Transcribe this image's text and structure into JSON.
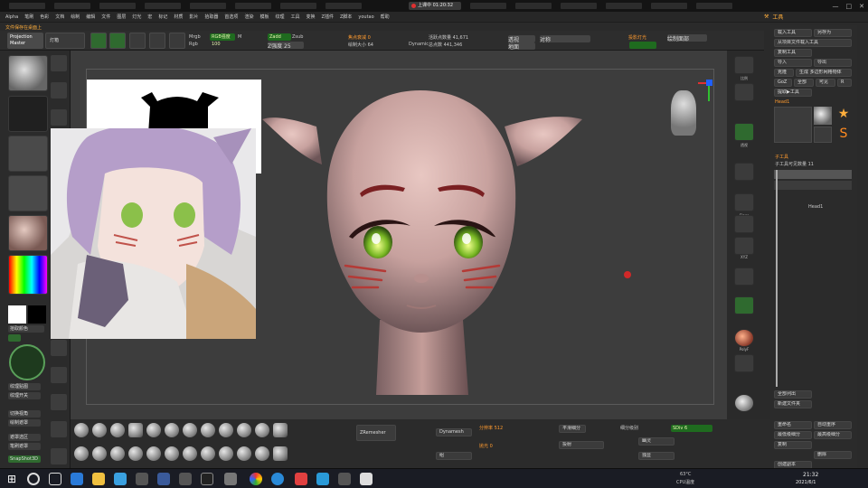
{
  "recording": {
    "label": "上课中 01:20:32"
  },
  "menu": [
    "Alpha",
    "笔刷",
    "色彩",
    "文档",
    "绘制",
    "编辑",
    "文件",
    "图层",
    "灯光",
    "宏",
    "标记",
    "材质",
    "影片",
    "拾取器",
    "首选项",
    "渲染",
    "模板",
    "纹理",
    "工具",
    "变换",
    "Z插件",
    "Z脚本",
    "youtao",
    "帮助"
  ],
  "tools_header": "工具",
  "notice": "文件保存在桌面上",
  "projection_master": "Projection Master",
  "lightbox_label": "灯箱",
  "shelf": {
    "edit": "编辑",
    "draw": "绘制",
    "move": "移动",
    "scale": "缩放",
    "rotate": "旋转",
    "mrgb_label": "Mrgb",
    "rgb_label": "Rgb",
    "m_label": "M",
    "zadd_label": "Zadd",
    "zsub_label": "Zsub",
    "zcut_label": "Zcut",
    "focal_label": "焦点衰减 0",
    "draw_size": "绘制大小 64",
    "dynamic_label": "Dynamic",
    "active_points": "活跃点数量 41,671",
    "total_points": "总点数 441,346",
    "rgb_intensity": "RGB强度 100",
    "z_intensity": "Z强度 25",
    "persp_label": "透视",
    "floor_label": "地面",
    "axis_label": "对称",
    "spotlight": "投影灯光",
    "mesh_label": "绘制面部"
  },
  "left": {
    "color_label": "拾取颜色",
    "btns": [
      "纹理贴图",
      "纹理开关",
      "切换视角",
      "绘制遮罩",
      "遮罩选区",
      "笔刷遮罩",
      "SnapShot3D"
    ],
    "gizmo_labels": [
      "DragDot",
      "Maskpen",
      "DragRect",
      "Move",
      "Clip",
      "Sel_Rect",
      "Sel_Lasso"
    ]
  },
  "dock": [
    "比例",
    "透视",
    "Floor",
    "本地",
    "L.Sym",
    "XYZ",
    "Frame",
    "移动",
    "缩放",
    "旋转",
    "PolyF",
    "Transp",
    "Ghost",
    "Solo",
    "Xpose"
  ],
  "rpanel": {
    "btns_top": [
      "载入工具",
      "另存为",
      "从项目文件载入工具",
      "复制工具",
      "导入",
      "导出",
      "克隆",
      "生成 多边形网格物体",
      "GoZ",
      "全部",
      "可见",
      "R",
      "提取▶工具"
    ],
    "tool_name": "Head1",
    "subtool_header": "子工具",
    "subtool_count": "子工具可见数量 11",
    "subtool_item": "Head1",
    "btns_mid": [
      "全部列出",
      "新建文件夹"
    ],
    "btns_bottom": [
      "重命名",
      "自动重序",
      "最低级细分",
      "最高级细分",
      "复制",
      "删除",
      "创建副本",
      "附加",
      "移除"
    ]
  },
  "bottom": {
    "brushes": [
      "Standard",
      "Clay",
      "ClayBuild",
      "ClayTubes",
      "Damstd",
      "Dam_std",
      "Inflat",
      "Smooth",
      "Layer",
      "Pinch",
      "Zmodel",
      "ZRemesh",
      "SnakeHook",
      "MoveTopo",
      "Move",
      "hPolish",
      "Slash3",
      "Flatten",
      "Curve",
      "Topo",
      "Chisel",
      "Planar",
      "TrimDyn",
      "ZBrush"
    ],
    "zremesher": "ZRemesher",
    "dynamesh": "Dynamesh",
    "resolution": "分辨率 512",
    "polish": "抛光 0",
    "smooth_sub": "平滑细分",
    "projection": "投射",
    "group_btn": "组",
    "subdiv": "细分级别",
    "active_level": "SDiv 6",
    "ghost": "幽灵",
    "solo": "独显"
  },
  "taskbar": {
    "temp": "63°C",
    "cpu": "CPU温度",
    "time": "21:32",
    "date": "2021/6/1"
  },
  "colors": {
    "accent_green": "#1f6b1f",
    "orange": "#ff9b2f",
    "background": "#3d3d3d"
  }
}
